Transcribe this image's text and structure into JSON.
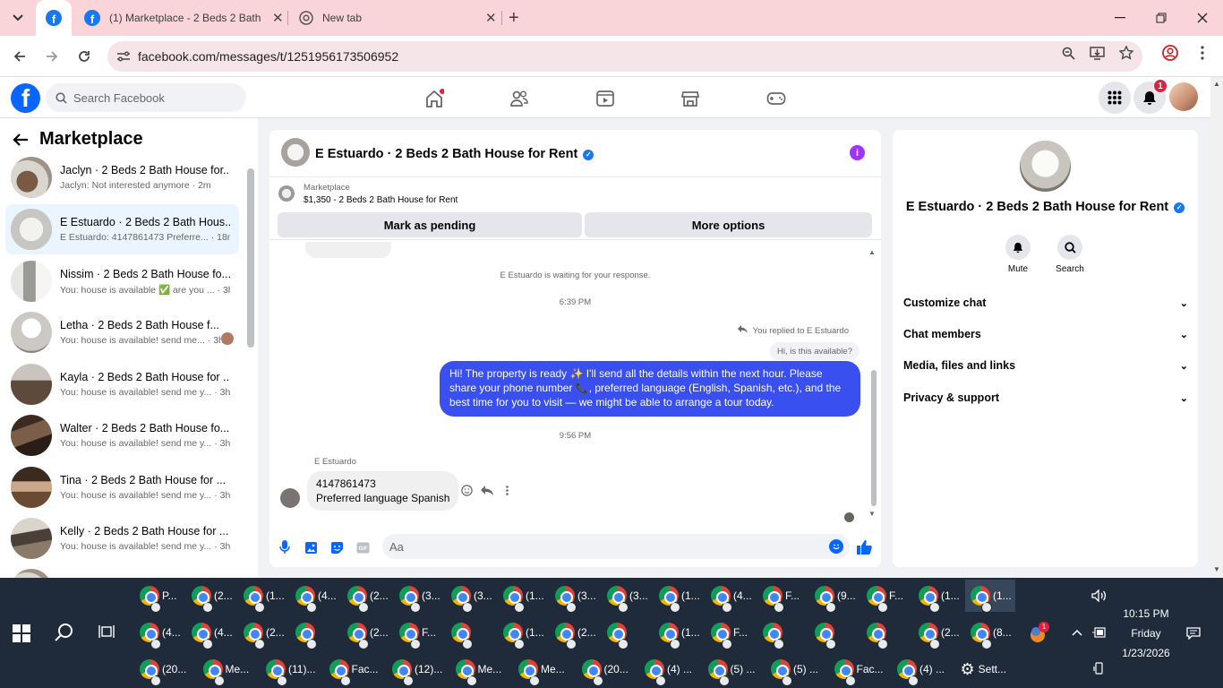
{
  "browser": {
    "tabs": [
      {
        "title": "(1) Marketplace - 2 Beds 2 Bath",
        "close": "✕"
      },
      {
        "title": "New tab",
        "close": "✕"
      }
    ],
    "new_tab": "+",
    "url": "facebook.com/messages/t/1251956173506952"
  },
  "fb": {
    "logo": "f",
    "search_placeholder": "Search Facebook",
    "notification_count": "1"
  },
  "sidebar": {
    "title": "Marketplace",
    "conversations": [
      {
        "name": "Jaclyn · 2 Beds 2 Bath House for...",
        "preview": "Jaclyn: Not interested anymore · 2m"
      },
      {
        "name": "E Estuardo · 2 Beds 2 Bath Hous...",
        "preview": "E Estuardo: 4147861473 Preferre... · 18m"
      },
      {
        "name": "Nissim · 2 Beds 2 Bath House fo...",
        "preview": "You: house is available ✅ are you ... · 3h"
      },
      {
        "name": "Letha · 2 Beds 2 Bath House f...",
        "preview": "You: house is available! send me... · 3h"
      },
      {
        "name": "Kayla · 2 Beds 2 Bath House for ...",
        "preview": "You: house is available! send me y... · 3h"
      },
      {
        "name": "Walter · 2 Beds 2 Bath House fo...",
        "preview": "You: house is available! send me y... · 3h"
      },
      {
        "name": "Tina · 2 Beds 2 Bath House for ...",
        "preview": "You: house is available! send me y... · 3h"
      },
      {
        "name": "Kelly · 2 Beds 2 Bath House for ...",
        "preview": "You: house is available! send me y... · 3h"
      }
    ]
  },
  "chat": {
    "title": "E Estuardo · 2 Beds 2 Bath House for Rent",
    "marketplace_label": "Marketplace",
    "listing": "$1,350 - 2 Beds 2 Bath House for Rent",
    "mark_pending": "Mark as pending",
    "more_options": "More options",
    "waiting_notice": "E Estuardo is waiting for your response.",
    "time1": "6:39 PM",
    "reply_note": "You replied to E Estuardo",
    "quoted_msg": "Hi, is this available?",
    "outgoing_msg": "Hi! The property is ready ✨ I'll send all the details within the next hour. Please share your phone number 📞, preferred language (English, Spanish, etc.), and the best time for you to visit — we might be able to arrange a tour today.",
    "time2": "9:56 PM",
    "sender": "E Estuardo",
    "incoming_line1": "4147861473",
    "incoming_line2": "Preferred language Spanish",
    "composer_placeholder": "Aa"
  },
  "info": {
    "title": "E Estuardo · 2 Beds 2 Bath House for Rent",
    "mute": "Mute",
    "search": "Search",
    "sections": [
      "Customize chat",
      "Chat members",
      "Media, files and links",
      "Privacy & support"
    ]
  },
  "taskbar": {
    "row1": [
      "P...",
      "(2...",
      "(1...",
      "(4...",
      "(2...",
      "(3...",
      "(3...",
      "(1...",
      "(3...",
      "(3...",
      "(1...",
      "(4...",
      "F...",
      "(9...",
      "F...",
      "(1...",
      "(1..."
    ],
    "row2": [
      "(4...",
      "(4...",
      "(2...",
      "",
      "(2...",
      "F...",
      "",
      "(1...",
      "(2...",
      "",
      "(1...",
      "F...",
      "",
      "",
      "",
      "(2...",
      "(8..."
    ],
    "row3": [
      "(20...",
      "Me...",
      "(11)...",
      "Fac...",
      "(12)...",
      "Me...",
      "Me...",
      "(20...",
      "(4) ...",
      "(5) ...",
      "(5) ...",
      "Fac...",
      "(4) ...",
      "Sett..."
    ],
    "time": "10:15 PM",
    "day": "Friday",
    "date": "1/23/2026",
    "tray_badge": "1"
  }
}
